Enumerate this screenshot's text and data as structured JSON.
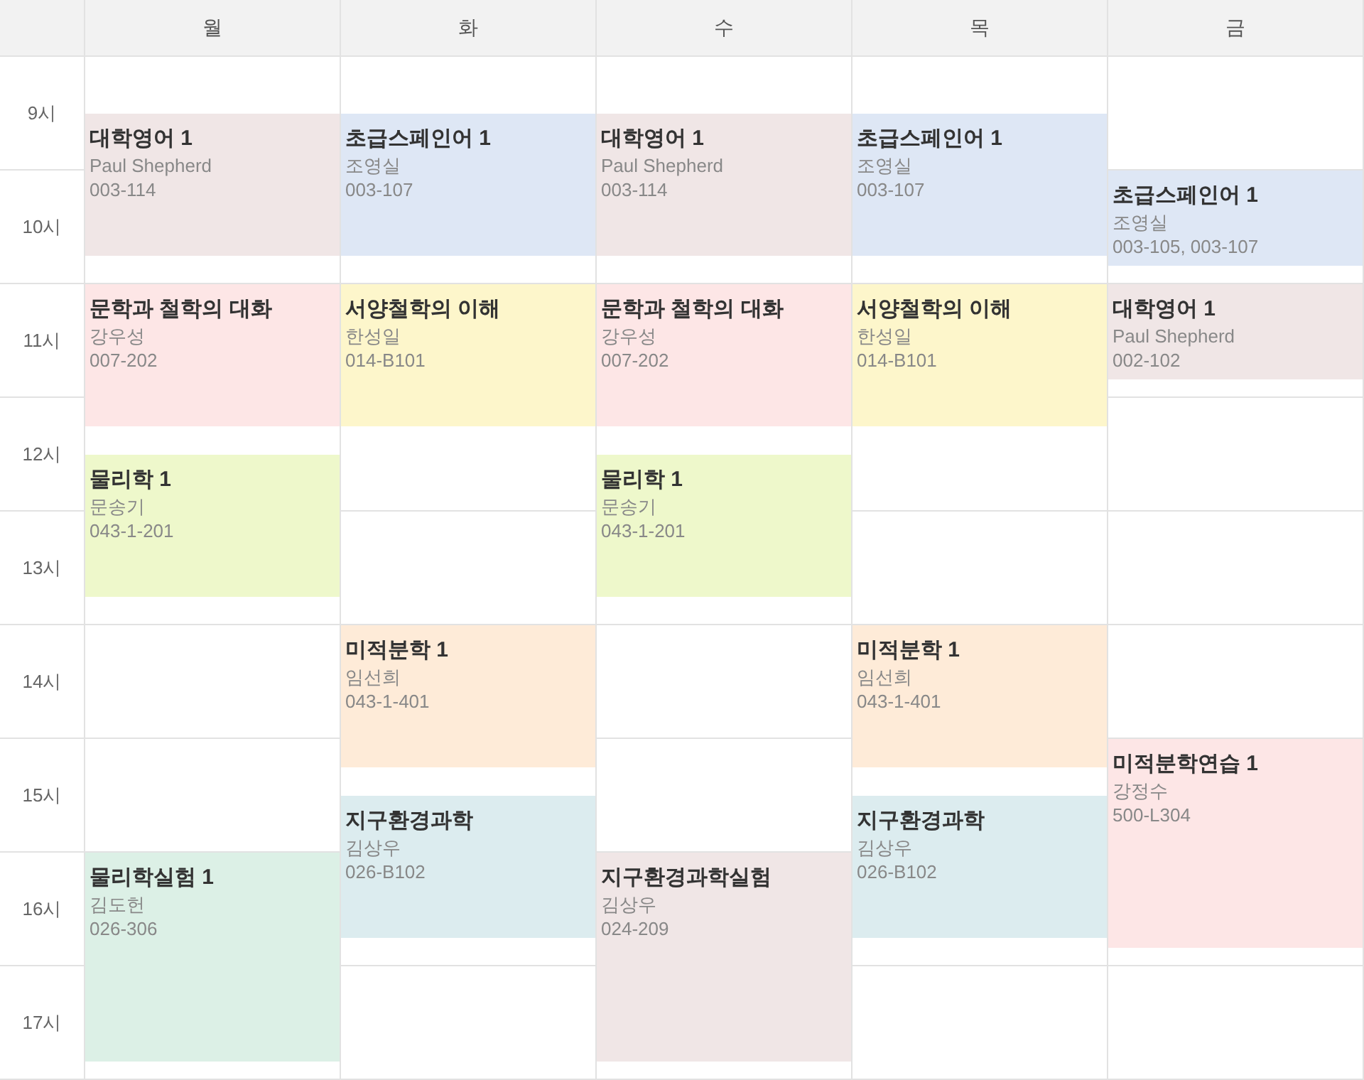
{
  "days": [
    {
      "label": "월",
      "events": [
        {
          "title": "대학영어 1",
          "instructor": "Paul Shepherd",
          "room": "003-114",
          "kind": "slot1",
          "color": "#f0e6e6"
        },
        {
          "title": "문학과 철학의 대화",
          "instructor": "강우성",
          "room": "007-202",
          "kind": "slot2",
          "color": "#fde6e6"
        },
        {
          "title": "물리학 1",
          "instructor": "문송기",
          "room": "043-1-201",
          "kind": "slot3",
          "color": "#eef8cb"
        },
        {
          "title": "물리학실험 1",
          "instructor": "김도헌",
          "room": "026-306",
          "kind": "lab",
          "color": "#dcf0e6"
        }
      ]
    },
    {
      "label": "화",
      "events": [
        {
          "title": "초급스페인어 1",
          "instructor": "조영실",
          "room": "003-107",
          "kind": "slot1",
          "color": "#dee7f5"
        },
        {
          "title": "서양철학의 이해",
          "instructor": "한성일",
          "room": "014-B101",
          "kind": "slot2",
          "color": "#fdf6cb"
        },
        {
          "title": "미적분학 1",
          "instructor": "임선희",
          "room": "043-1-401",
          "kind": "slot4",
          "color": "#feebd8"
        },
        {
          "title": "지구환경과학",
          "instructor": "김상우",
          "room": "026-B102",
          "kind": "slot5",
          "color": "#dcecef"
        }
      ]
    },
    {
      "label": "수",
      "events": [
        {
          "title": "대학영어 1",
          "instructor": "Paul Shepherd",
          "room": "003-114",
          "kind": "slot1",
          "color": "#f0e6e6"
        },
        {
          "title": "문학과 철학의 대화",
          "instructor": "강우성",
          "room": "007-202",
          "kind": "slot2",
          "color": "#fde6e6"
        },
        {
          "title": "물리학 1",
          "instructor": "문송기",
          "room": "043-1-201",
          "kind": "slot3",
          "color": "#eef8cb"
        },
        {
          "title": "지구환경과학실험",
          "instructor": "김상우",
          "room": "024-209",
          "kind": "lab",
          "color": "#f0e6e6"
        }
      ]
    },
    {
      "label": "목",
      "events": [
        {
          "title": "초급스페인어 1",
          "instructor": "조영실",
          "room": "003-107",
          "kind": "slot1",
          "color": "#dee7f5"
        },
        {
          "title": "서양철학의 이해",
          "instructor": "한성일",
          "room": "014-B101",
          "kind": "slot2",
          "color": "#fdf6cb"
        },
        {
          "title": "미적분학 1",
          "instructor": "임선희",
          "room": "043-1-401",
          "kind": "slot4",
          "color": "#feebd8"
        },
        {
          "title": "지구환경과학",
          "instructor": "김상우",
          "room": "026-B102",
          "kind": "slot5",
          "color": "#dcecef"
        }
      ]
    },
    {
      "label": "금",
      "events": [
        {
          "title": "초급스페인어 1",
          "instructor": "조영실",
          "room": "003-105, 003-107",
          "kind": "hour10",
          "color": "#dee7f5"
        },
        {
          "title": "대학영어 1",
          "instructor": "Paul Shepherd",
          "room": "002-102",
          "kind": "hour11",
          "color": "#f0e6e6"
        },
        {
          "title": "미적분학연습 1",
          "instructor": "강정수",
          "room": "500-L304",
          "kind": "practice",
          "color": "#fde6e6"
        }
      ]
    }
  ],
  "hours": [
    "9시",
    "10시",
    "11시",
    "12시",
    "13시",
    "14시",
    "15시",
    "16시",
    "17시"
  ]
}
